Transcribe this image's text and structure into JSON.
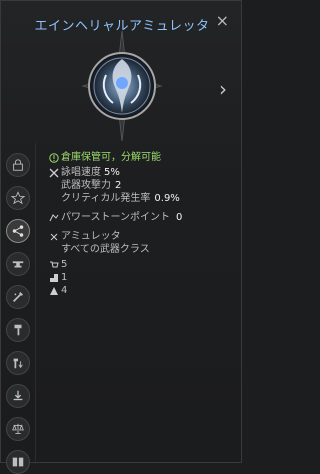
{
  "header": {
    "title": "エインヘリャルアミュレッタ",
    "close_label": "×"
  },
  "colors": {
    "title": "#8fc4ff",
    "green": "#9ddc6b",
    "bg": "#1c1d1f"
  },
  "stats": {
    "storage_line": "倉庫保管可，分解可能",
    "cast_speed_label": "詠唱速度",
    "cast_speed_value": "5%",
    "weapon_attack_label": "武器攻撃力",
    "weapon_attack_value": "2",
    "crit_label": "クリティカル発生率",
    "crit_value": "0.9%",
    "pp_label": "パワーストーンポイント",
    "pp_value": "0",
    "item_type": "アミュレッタ",
    "class_line": "すべての武器クラス",
    "val_1": "5",
    "val_2": "1",
    "val_3": "4"
  }
}
